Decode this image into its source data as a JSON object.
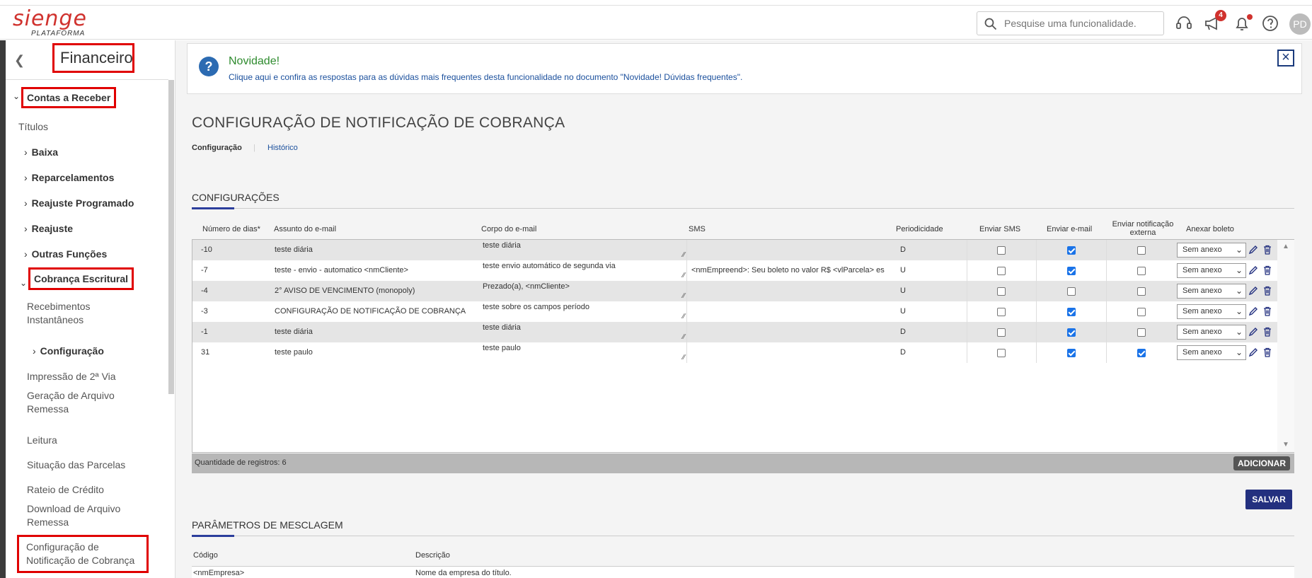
{
  "app": {
    "logo": "sienge",
    "logo_sub": "PLATAFORMA",
    "search_placeholder": "Pesquise uma funcionalidade.",
    "notification_count": "4",
    "avatar_initials": "PD"
  },
  "sidebar": {
    "title": "Financeiro",
    "contas_receber": "Contas a Receber",
    "titulos": "Títulos",
    "baixa": "Baixa",
    "reparcelamentos": "Reparcelamentos",
    "reajuste_programado": "Reajuste Programado",
    "reajuste": "Reajuste",
    "outras_funcoes": "Outras Funções",
    "cobranca_escritural": "Cobrança Escritural",
    "recebimentos_1": "Recebimentos",
    "recebimentos_2": "Instantâneos",
    "configuracao": "Configuração",
    "impressao": "Impressão de 2ª Via",
    "geracao_1": "Geração de Arquivo",
    "geracao_2": "Remessa",
    "leitura": "Leitura",
    "situacao": "Situação das Parcelas",
    "rateio": "Rateio de Crédito",
    "download_1": "Download de Arquivo",
    "download_2": "Remessa",
    "config_notif_1": "Configuração de",
    "config_notif_2": "Notificação de Cobrança"
  },
  "banner": {
    "title": "Novidade!",
    "text": "Clique aqui e confira as respostas para as dúvidas mais frequentes desta funcionalidade no documento \"Novidade! Dúvidas frequentes\"."
  },
  "page": {
    "title": "CONFIGURAÇÃO DE NOTIFICAÇÃO DE COBRANÇA",
    "tab_config": "Configuração",
    "tab_hist": "Histórico",
    "section_config": "CONFIGURAÇÕES",
    "section_merge": "PARÂMETROS DE MESCLAGEM",
    "count_label": "Quantidade de registros: 6",
    "add_button": "ADICIONAR",
    "save_button": "SALVAR"
  },
  "table": {
    "headers": {
      "dias": "Número de dias*",
      "assunto": "Assunto do e-mail",
      "corpo": "Corpo do e-mail",
      "sms": "SMS",
      "periodicidade": "Periodicidade",
      "enviar_sms": "Enviar SMS",
      "enviar_email": "Enviar e-mail",
      "enviar_notif_1": "Enviar notificação",
      "enviar_notif_2": "externa",
      "anexar": "Anexar boleto"
    },
    "rows": [
      {
        "dias": "-10",
        "assunto": "teste diária",
        "corpo": "teste diária",
        "sms": "",
        "per": "D",
        "sms_on": false,
        "email_on": true,
        "notif_on": false,
        "anexo": "Sem anexo"
      },
      {
        "dias": "-7",
        "assunto": "teste - envio - automatico <nmCliente>",
        "corpo": "teste envio automático de segunda via",
        "sms": "<nmEmpreend>: Seu boleto no valor R$ <vlParcela> es",
        "per": "U",
        "sms_on": false,
        "email_on": true,
        "notif_on": false,
        "anexo": "Sem anexo"
      },
      {
        "dias": "-4",
        "assunto": "2° AVISO DE VENCIMENTO (monopoly)",
        "corpo": "Prezado(a), <nmCliente>",
        "sms": "",
        "per": "U",
        "sms_on": false,
        "email_on": false,
        "notif_on": false,
        "anexo": "Sem anexo"
      },
      {
        "dias": "-3",
        "assunto": "CONFIGURAÇÃO DE NOTIFICAÇÃO DE COBRANÇA",
        "corpo": "teste sobre os campos período",
        "sms": "",
        "per": "U",
        "sms_on": false,
        "email_on": true,
        "notif_on": false,
        "anexo": "Sem anexo"
      },
      {
        "dias": "-1",
        "assunto": "teste diária",
        "corpo": "teste diária",
        "sms": "",
        "per": "D",
        "sms_on": false,
        "email_on": true,
        "notif_on": false,
        "anexo": "Sem anexo"
      },
      {
        "dias": "31",
        "assunto": "teste paulo",
        "corpo": "teste paulo",
        "sms": "",
        "per": "D",
        "sms_on": false,
        "email_on": true,
        "notif_on": true,
        "anexo": "Sem anexo"
      }
    ]
  },
  "merge": {
    "col_codigo": "Código",
    "col_descricao": "Descrição",
    "row1_codigo": "<nmEmpresa>",
    "row1_descricao": "Nome da empresa do título."
  },
  "colors": {
    "brand_red": "#d0322e",
    "highlight_red": "#e00000",
    "primary_blue": "#23307f",
    "link_blue": "#1a4f9c",
    "check_blue": "#1a73e8"
  }
}
